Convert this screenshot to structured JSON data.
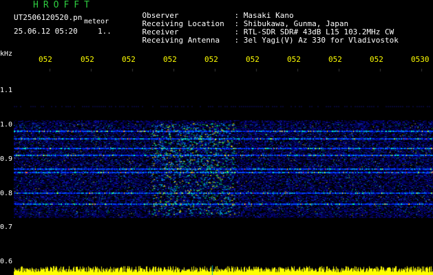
{
  "app": {
    "name": "HROFFT"
  },
  "file": {
    "name": "UT2506120520.pn",
    "suffix": "meteor"
  },
  "datetime": {
    "text": "25.06.12 05:20",
    "extra": "1.."
  },
  "header": {
    "rows": [
      {
        "label": "Observer",
        "value": ": Masaki Kano"
      },
      {
        "label": "Receiving Location",
        "value": ": Shibukawa, Gunma, Japan"
      },
      {
        "label": "Receiver",
        "value": ": RTL-SDR SDR# 43dB L15 103.2MHz CW"
      },
      {
        "label": "Receiving Antenna",
        "value": ": 3el Yagi(V) Az 330 for Vladivostok"
      }
    ]
  },
  "axis": {
    "unit": "kHz",
    "x_ticks": [
      "052",
      "052",
      "052",
      "052",
      "052",
      "052",
      "052",
      "052",
      "052",
      "0530"
    ],
    "y_ticks": [
      "1.1",
      "1.0",
      "0.9",
      "0.8",
      "0.7",
      "0.6"
    ],
    "y_range_khz": [
      0.6,
      1.15
    ]
  },
  "colors": {
    "background": "#000000",
    "title": "#2ecc40",
    "ticks": "#ffff00",
    "signal_low": "#0000cc",
    "signal_mid": "#00ff88",
    "signal_high": "#ff3030",
    "noise_bar": "#ffff00"
  },
  "chart_data": {
    "type": "heatmap",
    "x_categories": [
      "052",
      "052",
      "052",
      "052",
      "052",
      "052",
      "052",
      "052",
      "052",
      "0530"
    ],
    "ylabel": "kHz",
    "ylim": [
      0.6,
      1.15
    ],
    "band_center_khz": [
      0.76,
      1.005
    ],
    "strong_lines_khz": [
      0.985,
      0.965,
      0.94,
      0.92,
      0.885,
      0.875,
      0.82,
      0.79
    ]
  }
}
